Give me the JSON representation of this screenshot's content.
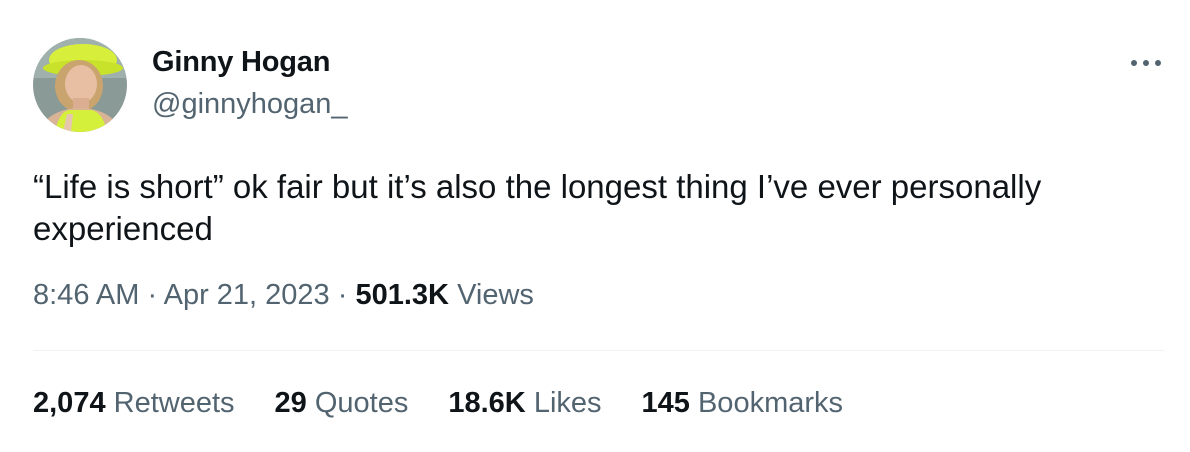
{
  "author": {
    "display_name": "Ginny Hogan",
    "handle": "@ginnyhogan_"
  },
  "tweet": {
    "text": "“Life is short” ok fair but it’s also the longest thing I’ve ever personally experienced",
    "time": "8:46 AM",
    "separator": "·",
    "date": "Apr 21, 2023",
    "views_count": "501.3K",
    "views_label": "Views"
  },
  "stats": {
    "retweets": {
      "count": "2,074",
      "label": "Retweets"
    },
    "quotes": {
      "count": "29",
      "label": "Quotes"
    },
    "likes": {
      "count": "18.6K",
      "label": "Likes"
    },
    "bookmarks": {
      "count": "145",
      "label": "Bookmarks"
    }
  },
  "icons": {
    "more": "more-horizontal-icon"
  },
  "colors": {
    "primary_text": "#0f1419",
    "secondary_text": "#536471",
    "divider": "#eff3f4"
  }
}
